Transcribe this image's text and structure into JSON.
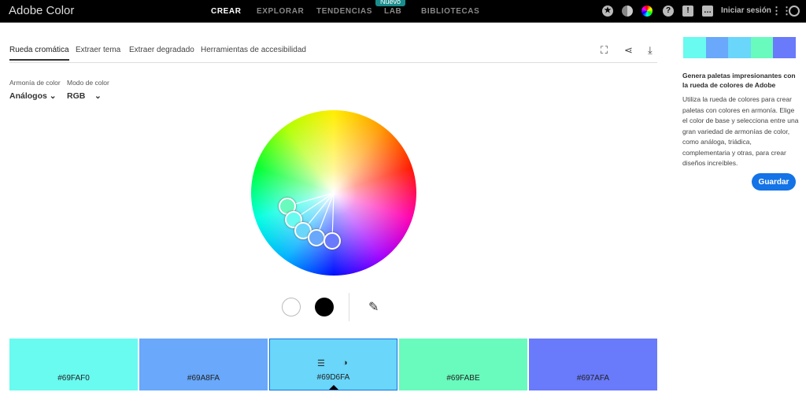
{
  "header": {
    "logo": "Adobe Color",
    "nav": [
      "CREAR",
      "EXPLORAR",
      "TENDENCIAS",
      "LAB",
      "BIBLIOTECAS"
    ],
    "badge": "Nuevo",
    "signin": "Iniciar sesión"
  },
  "tabs": [
    "Rueda cromática",
    "Extraer tema",
    "Extraer degradado",
    "Herramientas de accesibilidad"
  ],
  "controls": {
    "harmony_label": "Armonía de color",
    "harmony_value": "Análogos",
    "mode_label": "Modo de color",
    "mode_value": "RGB"
  },
  "swatches": [
    {
      "hex": "#69FAF0"
    },
    {
      "hex": "#69A8FA"
    },
    {
      "hex": "#69D6FA"
    },
    {
      "hex": "#69FABE"
    },
    {
      "hex": "#697AFA"
    }
  ],
  "selected_swatch": 2,
  "sidebar": {
    "heading": "Genera paletas impresionantes con la rueda de colores de Adobe",
    "body": "Utiliza la rueda de colores para crear paletas con colores en armonía. Elige el color de base y selecciona entre una gran variedad de armonías de color, como análoga, triádica, complementaria y otras, para crear diseños increíbles.",
    "save": "Guardar"
  }
}
